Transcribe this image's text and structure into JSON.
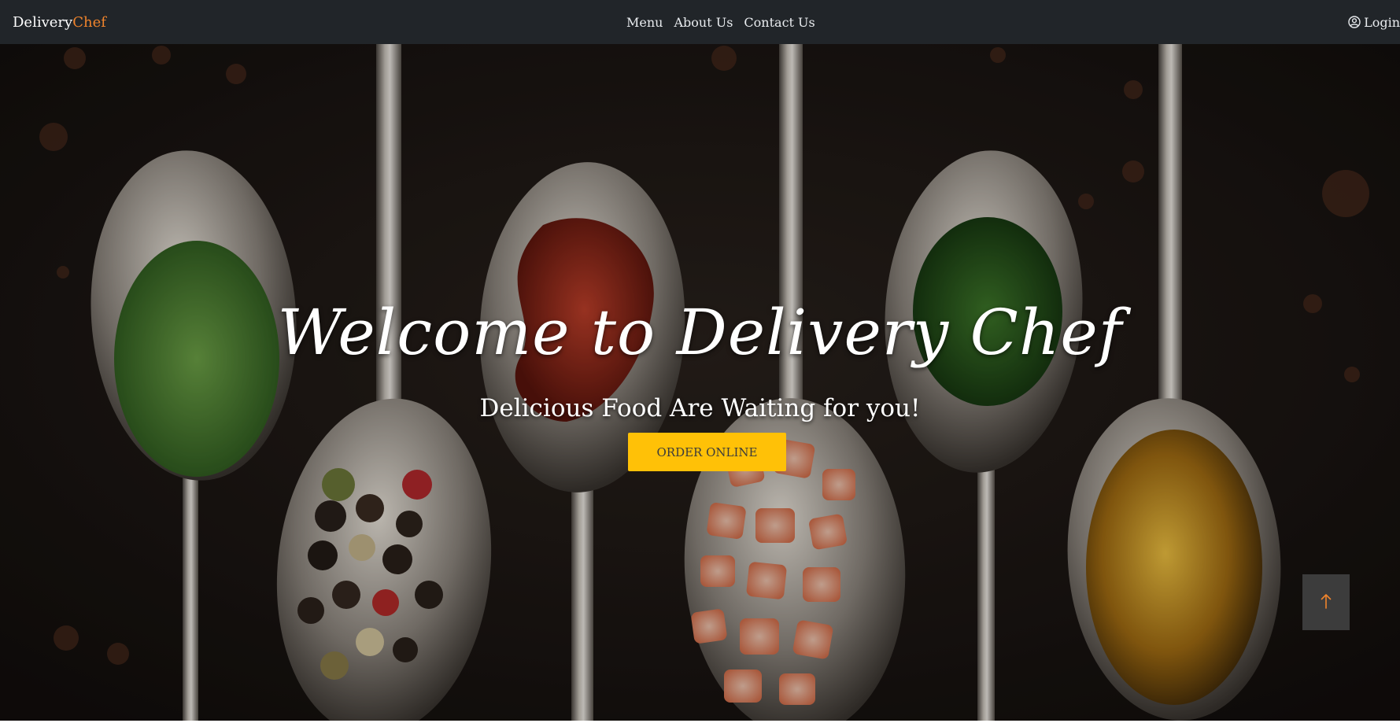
{
  "navbar": {
    "brand_primary": "Delivery",
    "brand_accent": "Chef",
    "links": [
      "Menu",
      "About Us",
      "Contact Us"
    ],
    "login_label": "Login",
    "login_icon": "user-circle-icon"
  },
  "hero": {
    "title": "Welcome to Delivery Chef",
    "subtitle": "Delicious Food Are Waiting for you!",
    "cta_label": "ORDER ONLINE",
    "scroll_top_icon": "arrow-up-icon"
  },
  "colors": {
    "navbar_bg": "#212529",
    "brand_accent": "#f0842c",
    "cta_bg": "#ffc107",
    "scroll_arrow": "#f0842c"
  }
}
